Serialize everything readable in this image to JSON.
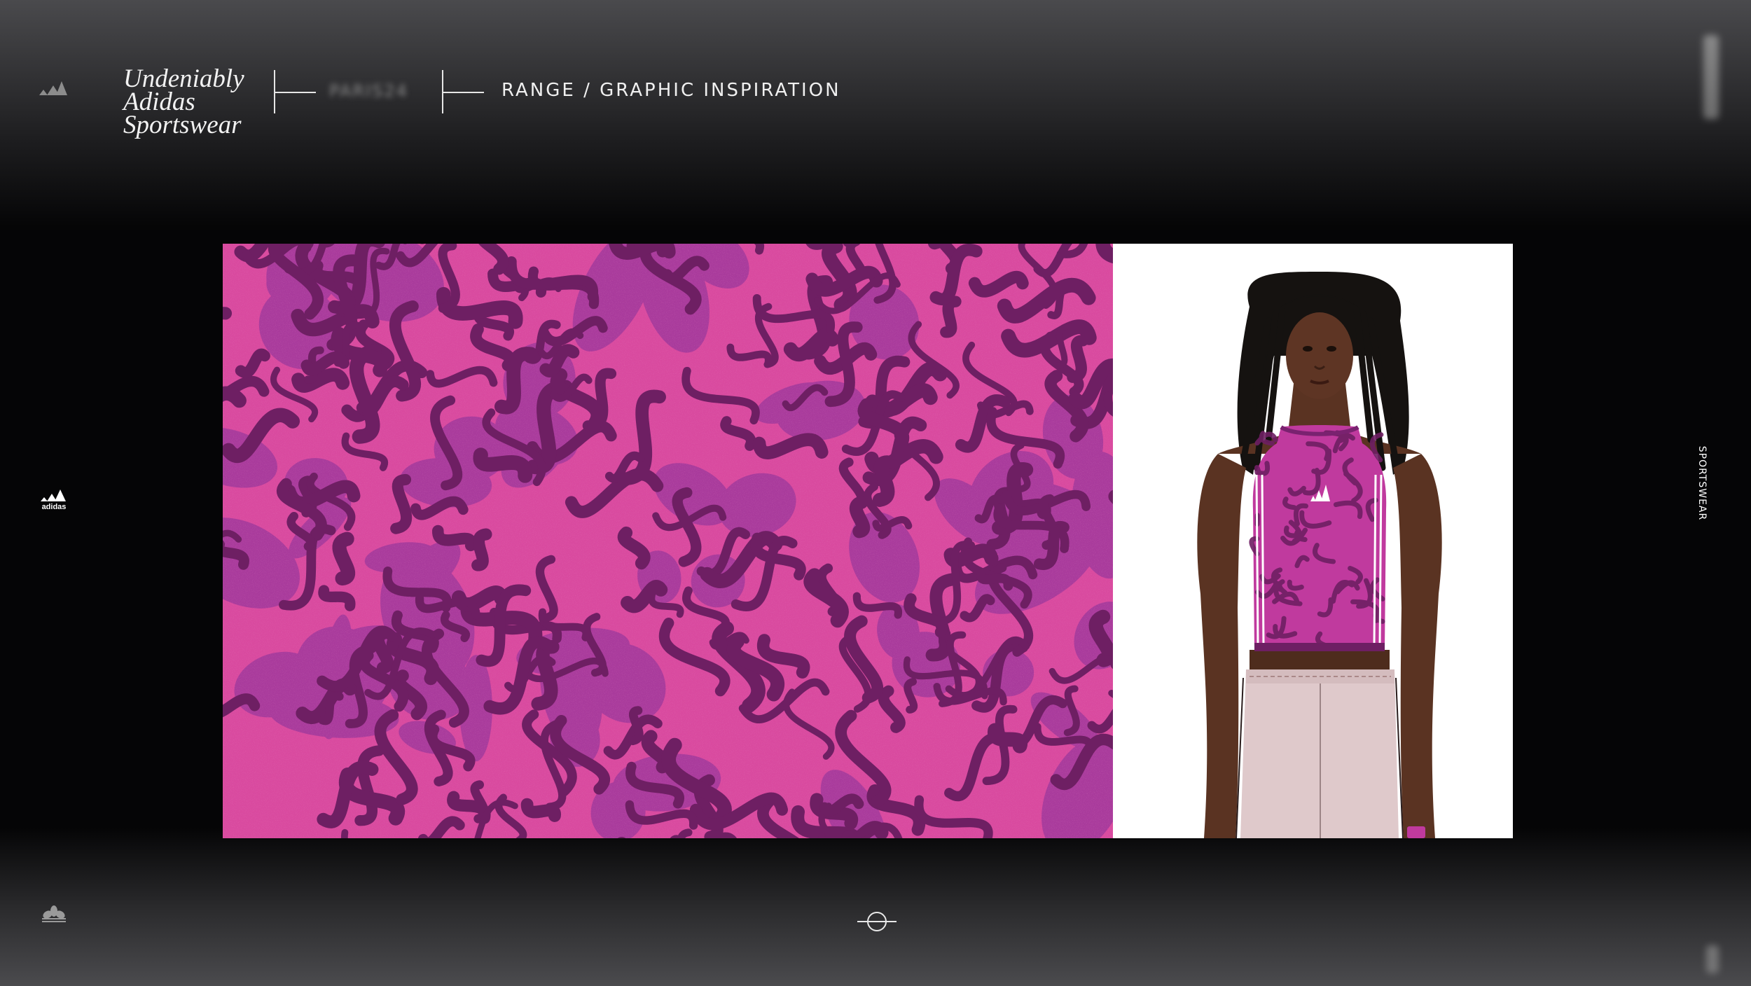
{
  "header": {
    "brand_tagline": [
      "Undeniably",
      "Adidas",
      "Sportswear"
    ],
    "blurred_label": "PARIS24",
    "section_title": "RANGE / GRAPHIC INSPIRATION"
  },
  "side": {
    "right_label": "SPORTSWEAR"
  },
  "main": {
    "pattern_colors": {
      "base": "#d94a9f",
      "mid": "#a43a9c",
      "dark": "#6e1f63"
    },
    "product": {
      "top_color": "#c03a9e",
      "bottom_color": "#dfc9cb",
      "logo_icon": "adidas-badge-of-sport-icon"
    }
  },
  "icons": {
    "top_left": "adidas-performance-logo-icon",
    "left_middle": "adidas-logo-icon",
    "bottom_left": "adidas-trefoil-icon",
    "bottom_center": "crosshair-icon"
  }
}
